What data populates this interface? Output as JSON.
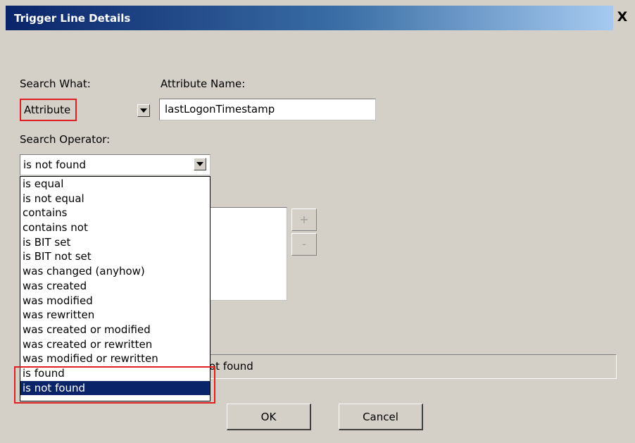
{
  "window": {
    "title": "Trigger Line Details",
    "close_glyph": "X"
  },
  "search_what": {
    "label": "Search What:",
    "selected": "Attribute"
  },
  "attribute_name": {
    "label": "Attribute Name:",
    "value": "lastLogonTimestamp"
  },
  "search_operator": {
    "label": "Search Operator:",
    "selected": "is not found",
    "options": [
      "is equal",
      "is not equal",
      "contains",
      "contains not",
      "is BIT set",
      "is BIT not set",
      "was changed (anyhow)",
      "was created",
      "was modified",
      "was rewritten",
      "was created or modified",
      "was created or rewritten",
      "was modified or rewritten",
      "is found",
      "is not found"
    ],
    "highlighted_index": 14
  },
  "values_list": {
    "add_label": "+",
    "remove_label": "-"
  },
  "summary": {
    "visible_text": "ot found"
  },
  "buttons": {
    "ok": "OK",
    "cancel": "Cancel"
  },
  "annotation": {
    "highlight_color": "#e02020"
  }
}
